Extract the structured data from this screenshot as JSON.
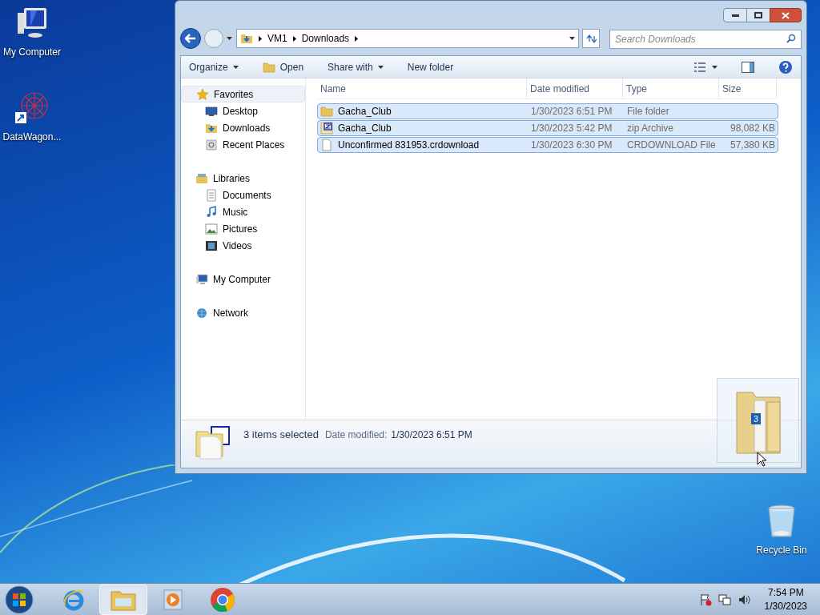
{
  "desktop_icons": [
    {
      "label": "My Computer",
      "kind": "computer"
    },
    {
      "label": "DataWagon...",
      "kind": "shortcut"
    },
    {
      "label": "Recycle Bin",
      "kind": "bin"
    }
  ],
  "window": {
    "breadcrumb": [
      "VM1",
      "Downloads"
    ],
    "search": {
      "placeholder": "Search Downloads"
    },
    "toolbar": [
      {
        "label": "Organize",
        "kind": "menu"
      },
      {
        "label": "Open",
        "kind": "open"
      },
      {
        "label": "Share with",
        "kind": "menu"
      },
      {
        "label": "New folder",
        "kind": "plain"
      }
    ],
    "nav": [
      {
        "label": "Favorites",
        "kind": "star",
        "selected": true,
        "children": [
          {
            "label": "Desktop",
            "kind": "desktop",
            "selected": false
          },
          {
            "label": "Downloads",
            "kind": "downloads",
            "selected": false
          },
          {
            "label": "Recent Places",
            "kind": "recent",
            "selected": false
          }
        ]
      },
      {
        "label": "Libraries",
        "kind": "library",
        "selected": false,
        "children": [
          {
            "label": "Documents",
            "kind": "documents",
            "selected": false
          },
          {
            "label": "Music",
            "kind": "music",
            "selected": false
          },
          {
            "label": "Pictures",
            "kind": "pictures",
            "selected": false
          },
          {
            "label": "Videos",
            "kind": "videos",
            "selected": false
          }
        ]
      },
      {
        "label": "My Computer",
        "kind": "computer",
        "selected": false
      },
      {
        "label": "Network",
        "kind": "network",
        "selected": false
      }
    ],
    "columns": [
      "Name",
      "Date modified",
      "Type",
      "Size"
    ],
    "files": [
      {
        "name": "Gacha_Club",
        "date": "1/30/2023 6:51 PM",
        "type": "File folder",
        "kind": "folder",
        "selected": true
      },
      {
        "name": "Gacha_Club",
        "date": "1/30/2023 5:42 PM",
        "type": "zip Archive",
        "size": "98,082 KB",
        "kind": "zip",
        "selected": true
      },
      {
        "name": "Unconfirmed 831953.crdownload",
        "date": "1/30/2023 6:30 PM",
        "type": "CRDOWNLOAD File",
        "size": "57,380 KB",
        "kind": "file",
        "selected": true
      }
    ],
    "details": {
      "summary": "3 items selected",
      "label": "Date modified:",
      "value": "1/30/2023 6:51 PM"
    }
  },
  "drag": {
    "count": "3"
  },
  "taskbar": {
    "apps": [
      {
        "kind": "ie",
        "selected": false
      },
      {
        "kind": "explorer",
        "selected": true
      },
      {
        "kind": "media",
        "selected": false
      },
      {
        "kind": "chrome",
        "selected": false
      }
    ],
    "time": "7:54 PM",
    "date": "1/30/2023"
  }
}
